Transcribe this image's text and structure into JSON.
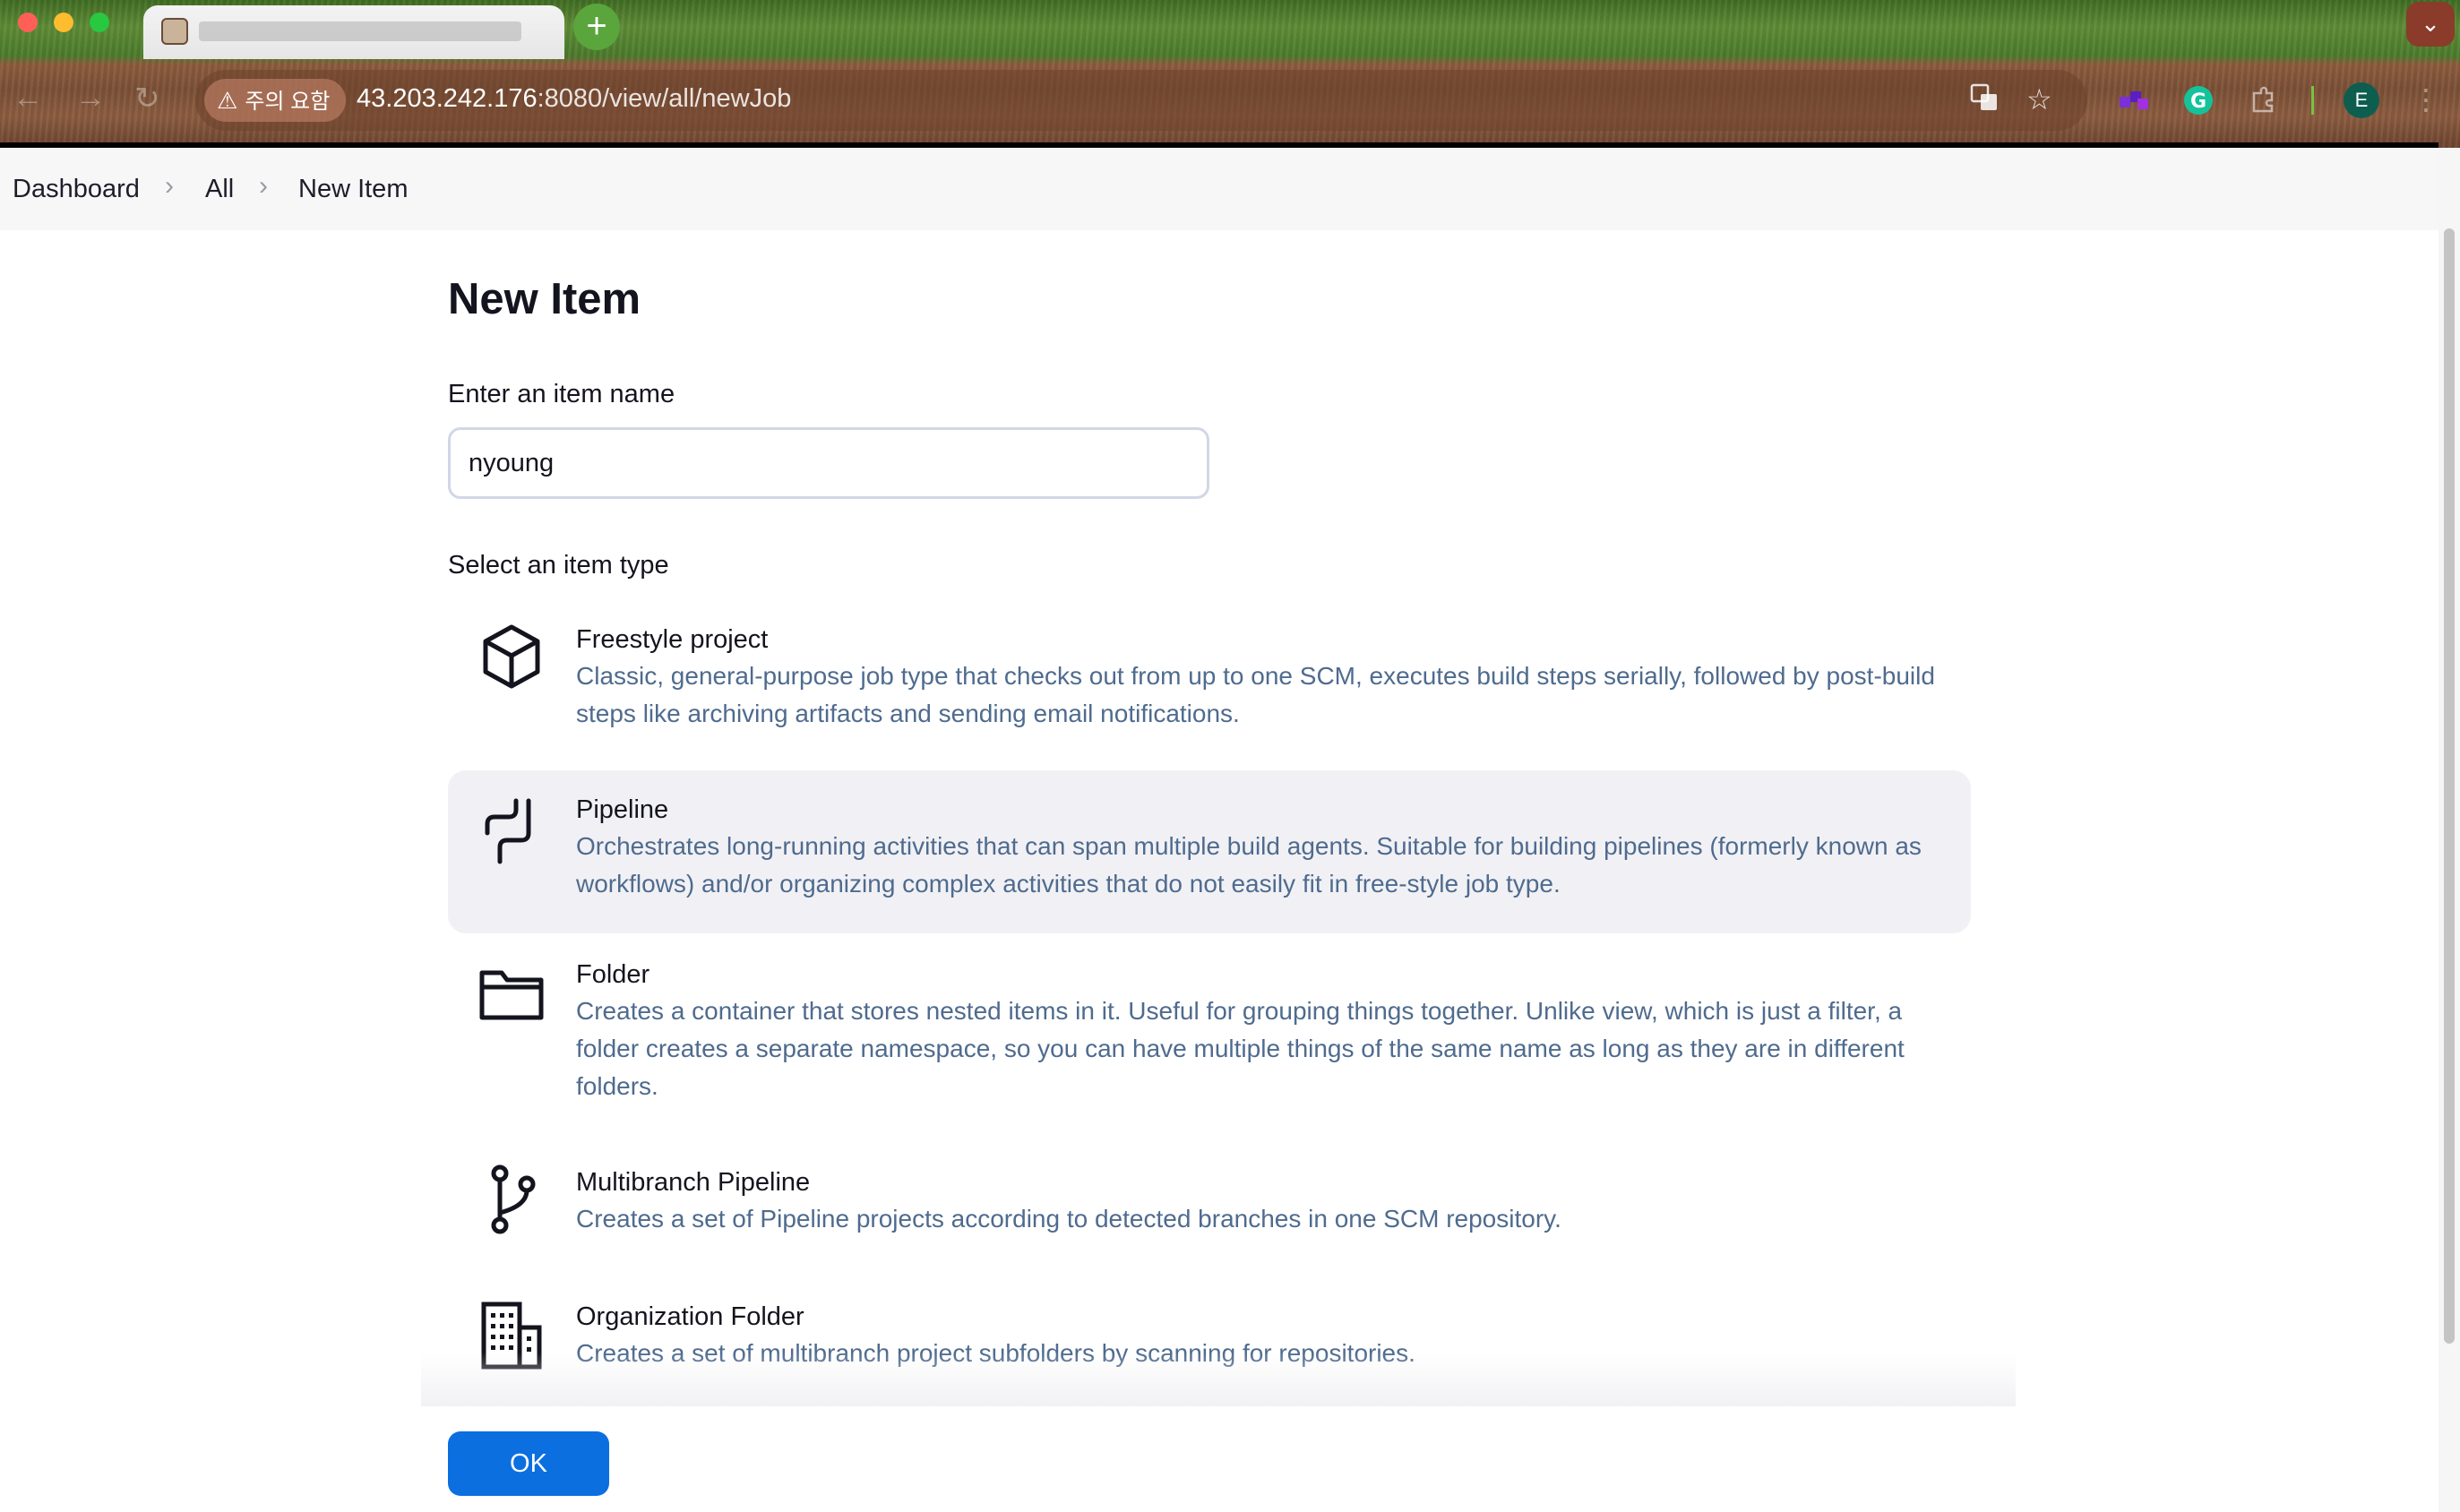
{
  "browser": {
    "address": {
      "security_label": "주의 요함",
      "url_host": "43.203.242.176",
      "url_rest": ":8080/view/all/newJob"
    },
    "profile_initial": "E",
    "new_tab_symbol": "+",
    "tab_menu_symbol": "⌄",
    "colors": {
      "profile": "#0e5e50",
      "new_tab": "#5aa53c"
    }
  },
  "breadcrumb": {
    "items": [
      "Dashboard",
      "All",
      "New Item"
    ],
    "separator": "›"
  },
  "page": {
    "title": "New Item",
    "name_label": "Enter an item name",
    "name_value": "nyoung",
    "type_label": "Select an item type"
  },
  "item_types": [
    {
      "icon": "cube-icon",
      "title": "Freestyle project",
      "description": "Classic, general-purpose job type that checks out from up to one SCM, executes build steps serially, followed by post-build steps like archiving artifacts and sending email notifications."
    },
    {
      "icon": "pipeline-icon",
      "title": "Pipeline",
      "description": "Orchestrates long-running activities that can span multiple build agents. Suitable for building pipelines (formerly known as workflows) and/or organizing complex activities that do not easily fit in free-style job type.",
      "selected": true
    },
    {
      "icon": "folder-icon",
      "title": "Folder",
      "description": "Creates a container that stores nested items in it. Useful for grouping things together. Unlike view, which is just a filter, a folder creates a separate namespace, so you can have multiple things of the same name as long as they are in different folders."
    },
    {
      "icon": "branch-icon",
      "title": "Multibranch Pipeline",
      "description": "Creates a set of Pipeline projects according to detected branches in one SCM repository."
    },
    {
      "icon": "building-icon",
      "title": "Organization Folder",
      "description": "Creates a set of multibranch project subfolders by scanning for repositories."
    }
  ],
  "actions": {
    "ok_label": "OK",
    "ok_color": "#0b6fe0"
  },
  "colors": {
    "description_text": "#4f6b8e",
    "selected_row": "#f1f1f5"
  }
}
